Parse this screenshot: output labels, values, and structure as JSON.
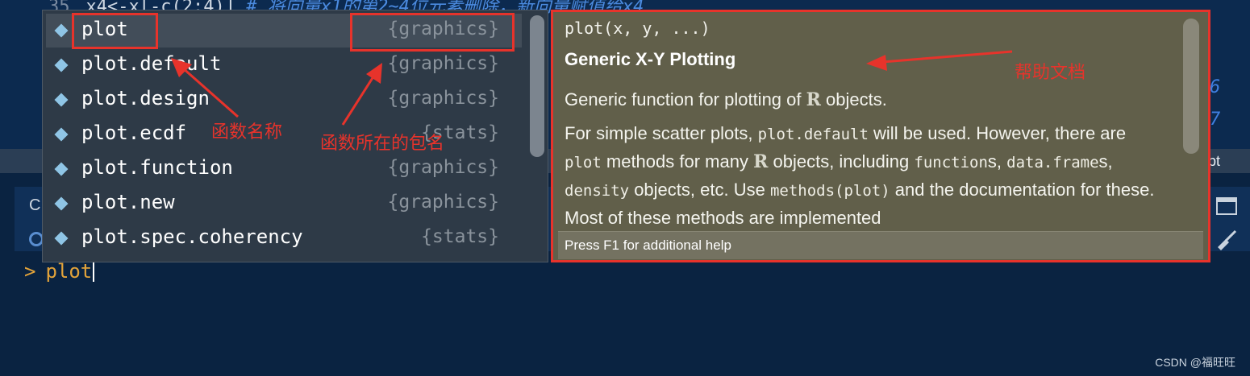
{
  "editor": {
    "line_number": "35",
    "line_code": "x4<-x[-c(2:4)]",
    "line_comment": "# 将向量x1的第2~4位元素删除，新向量赋值给x4",
    "right_numbers": [
      "6",
      "7"
    ]
  },
  "console_stub": {
    "c_label": "C",
    "pt_label": "pt"
  },
  "completion": {
    "items": [
      {
        "name": "plot",
        "package": "{graphics}"
      },
      {
        "name": "plot.default",
        "package": "{graphics}"
      },
      {
        "name": "plot.design",
        "package": "{graphics}"
      },
      {
        "name": "plot.ecdf",
        "package": "{stats}"
      },
      {
        "name": "plot.function",
        "package": "{graphics}"
      },
      {
        "name": "plot.new",
        "package": "{graphics}"
      },
      {
        "name": "plot.spec.coherency",
        "package": "{stats}"
      }
    ],
    "selected_index": 0
  },
  "help": {
    "signature": "plot(x, y, ...)",
    "title": "Generic X-Y Plotting",
    "p1_before": "Generic function for plotting of ",
    "p1_r": "R",
    "p1_after": " objects.",
    "p2_a": "For simple scatter plots, ",
    "p2_code1": "plot.default",
    "p2_b": " will be used. However, there are ",
    "p2_code2": "plot",
    "p2_c": " methods for many ",
    "p2_r": "R",
    "p2_d": " objects, including ",
    "p2_code3": "function",
    "p2_e": "s, ",
    "p2_code4": "data.frame",
    "p2_f": "s, ",
    "p2_code5": "density",
    "p2_g": " objects, etc. Use ",
    "p2_code6": "methods(plot)",
    "p2_h": " and the documentation for these. Most of these methods are implemented",
    "footer": "Press F1 for additional help"
  },
  "console": {
    "prompt": ">",
    "input": "plot"
  },
  "annotations": {
    "function_name": "函数名称",
    "package_name": "函数所在的包名",
    "help_doc": "帮助文档",
    "color": "#e7332b"
  },
  "watermark": "CSDN @福旺旺"
}
